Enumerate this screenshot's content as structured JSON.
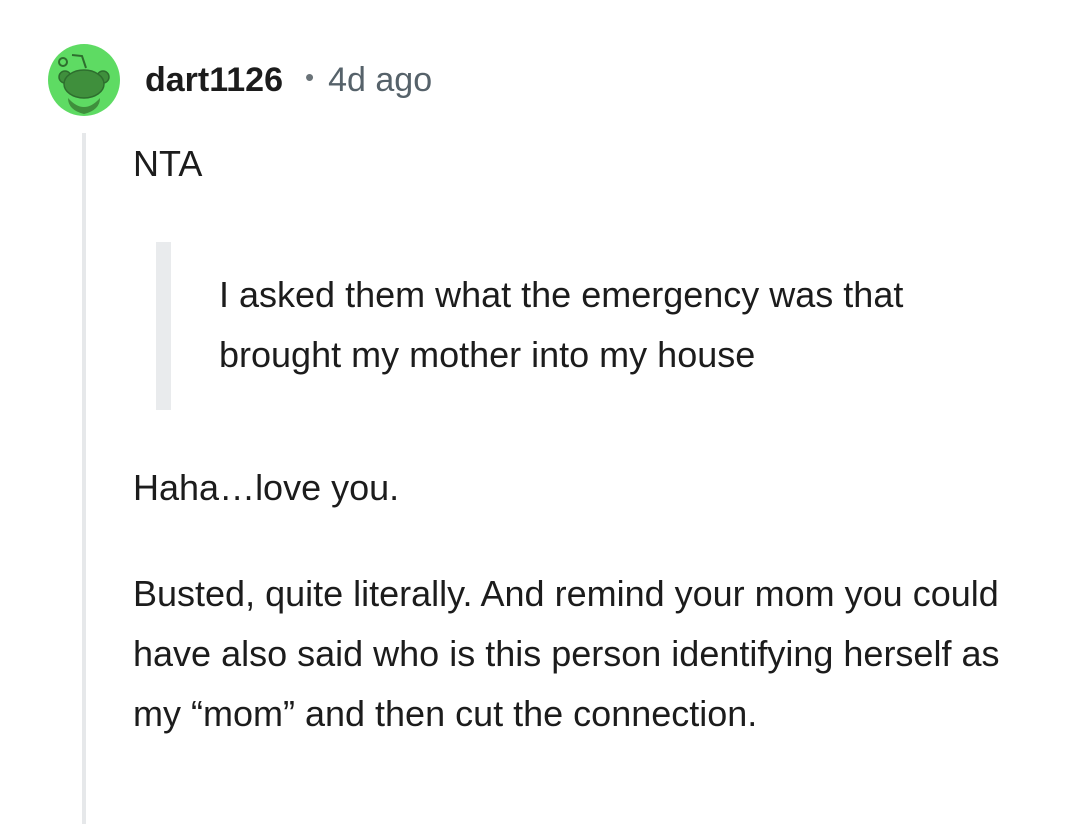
{
  "comment": {
    "username": "dart1126",
    "separator": "•",
    "timestamp": "4d ago",
    "avatar_icon": "snoo-avatar-icon",
    "avatar_color": "#5edb63",
    "paragraphs": {
      "verdict": "NTA",
      "quote": "I asked them what the emergency was that brought my mother into my house",
      "reaction": "Haha…love you.",
      "advice": "Busted, quite literally. And remind your mom you could have also said who is this person identifying herself as my “mom” and then cut the connection."
    }
  }
}
